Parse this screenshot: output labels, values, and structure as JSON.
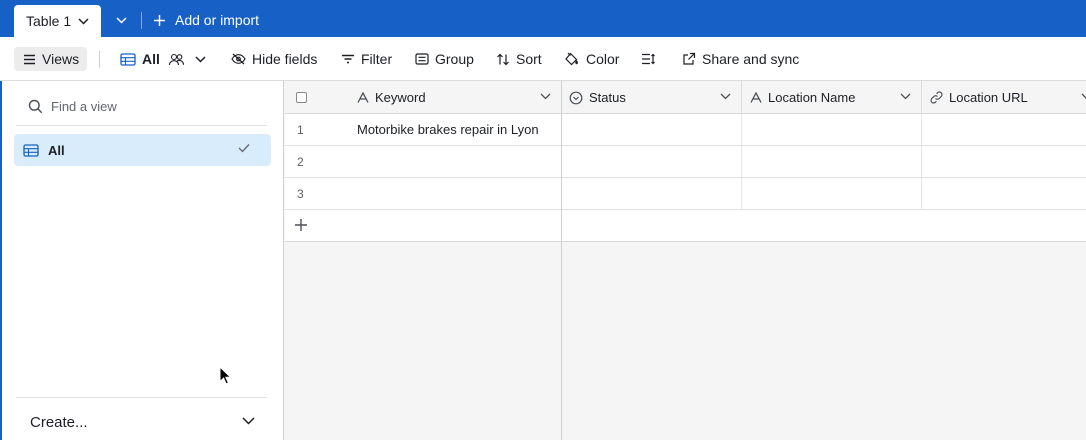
{
  "tabs": {
    "active_label": "Table 1",
    "add_import_label": "Add or import"
  },
  "toolbar": {
    "views_label": "Views",
    "view_name": "All",
    "hide_fields_label": "Hide fields",
    "filter_label": "Filter",
    "group_label": "Group",
    "sort_label": "Sort",
    "color_label": "Color",
    "share_label": "Share and sync"
  },
  "sidebar": {
    "search_placeholder": "Find a view",
    "views": [
      {
        "label": "All",
        "selected": true
      }
    ],
    "create_label": "Create..."
  },
  "grid": {
    "columns": [
      {
        "label": "Keyword",
        "icon": "text-icon"
      },
      {
        "label": "Status",
        "icon": "status-icon"
      },
      {
        "label": "Location Name",
        "icon": "text-icon"
      },
      {
        "label": "Location URL",
        "icon": "link-icon"
      }
    ],
    "rows": [
      {
        "num": "1",
        "keyword": "Motorbike brakes repair in Lyon",
        "status": "",
        "location_name": "",
        "location_url": ""
      },
      {
        "num": "2",
        "keyword": "",
        "status": "",
        "location_name": "",
        "location_url": ""
      },
      {
        "num": "3",
        "keyword": "",
        "status": "",
        "location_name": "",
        "location_url": ""
      }
    ]
  },
  "colors": {
    "brand_blue": "#1760c6",
    "selected_view_bg": "#d8ecfb"
  }
}
